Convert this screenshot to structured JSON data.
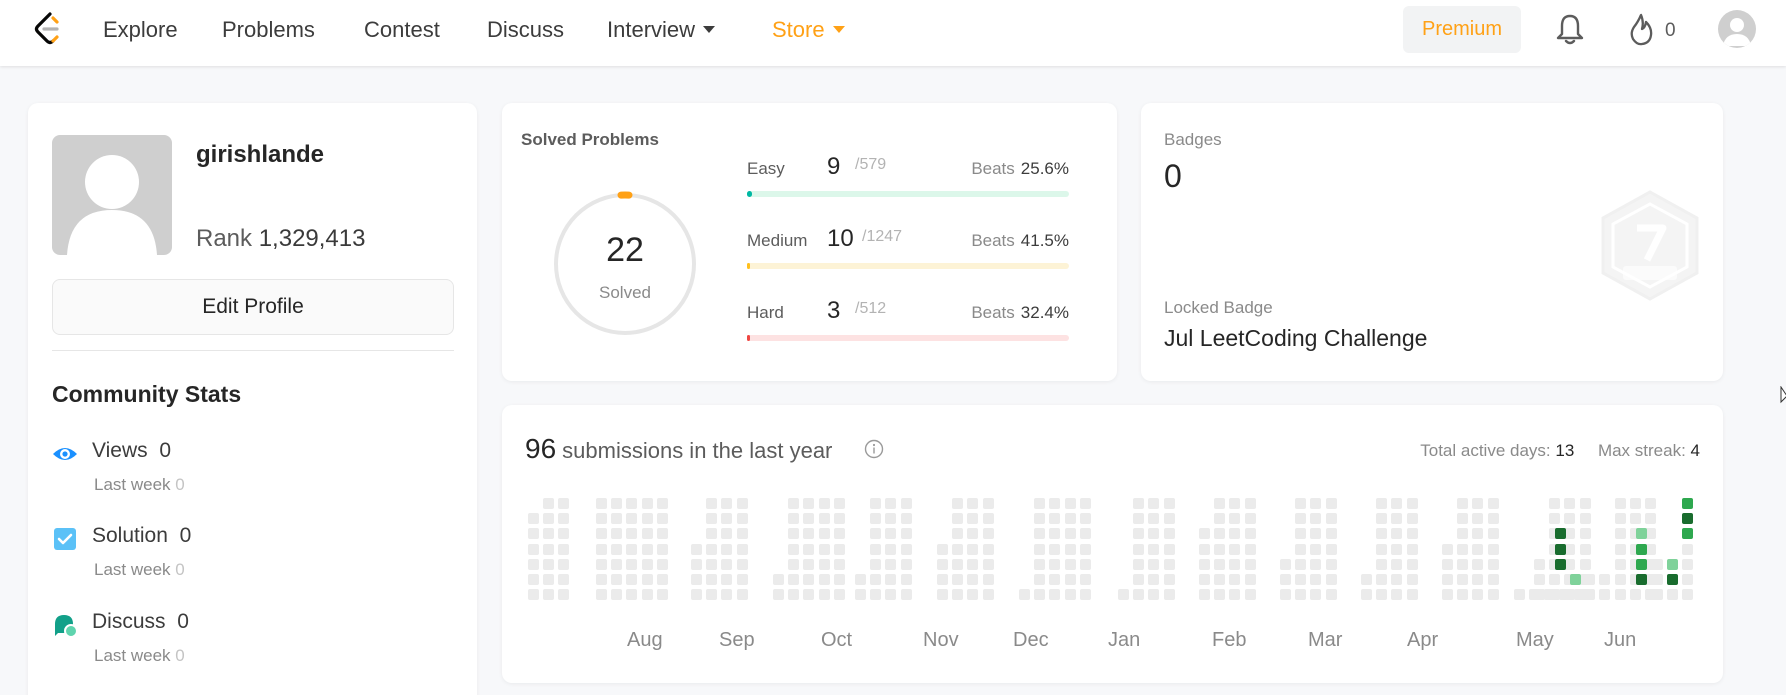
{
  "nav": {
    "items": [
      {
        "label": "Explore"
      },
      {
        "label": "Problems"
      },
      {
        "label": "Contest"
      },
      {
        "label": "Discuss"
      },
      {
        "label": "Interview"
      },
      {
        "label": "Store"
      }
    ],
    "premium_label": "Premium",
    "streak_count": "0"
  },
  "profile": {
    "username": "girishlande",
    "rank_label": "Rank",
    "rank_value": "1,329,413",
    "edit_label": "Edit Profile"
  },
  "community": {
    "title": "Community Stats",
    "stats": [
      {
        "label": "Views",
        "value": "0",
        "sub_label": "Last week",
        "sub_value": "0",
        "icon": "eye-icon"
      },
      {
        "label": "Solution",
        "value": "0",
        "sub_label": "Last week",
        "sub_value": "0",
        "icon": "checkbox-icon"
      },
      {
        "label": "Discuss",
        "value": "0",
        "sub_label": "Last week",
        "sub_value": "0",
        "icon": "discuss-icon"
      }
    ]
  },
  "solved": {
    "title": "Solved Problems",
    "total": "22",
    "total_label": "Solved",
    "rows": [
      {
        "label": "Easy",
        "count": "9",
        "total": "/579",
        "beats_label": "Beats",
        "beats": "25.6%",
        "fill": 0.0155,
        "color": "#00b8a3",
        "track": "#dcf7ea"
      },
      {
        "label": "Medium",
        "count": "10",
        "total": "/1247",
        "beats_label": "Beats",
        "beats": "41.5%",
        "fill": 0.008,
        "color": "#ffc01e",
        "track": "#fdf3d6"
      },
      {
        "label": "Hard",
        "count": "3",
        "total": "/512",
        "beats_label": "Beats",
        "beats": "32.4%",
        "fill": 0.0059,
        "color": "#ef4743",
        "track": "#fde2e2"
      }
    ]
  },
  "badges": {
    "title": "Badges",
    "count": "0",
    "locked_label": "Locked Badge",
    "locked_name": "Jul LeetCoding Challenge"
  },
  "submissions": {
    "count": "96",
    "title": "submissions in the last year",
    "active_days_label": "Total active days:",
    "active_days": "13",
    "max_streak_label": "Max streak:",
    "max_streak": "4",
    "months": [
      "Aug",
      "Sep",
      "Oct",
      "Nov",
      "Dec",
      "Jan",
      "Feb",
      "Mar",
      "Apr",
      "May",
      "Jun"
    ]
  }
}
